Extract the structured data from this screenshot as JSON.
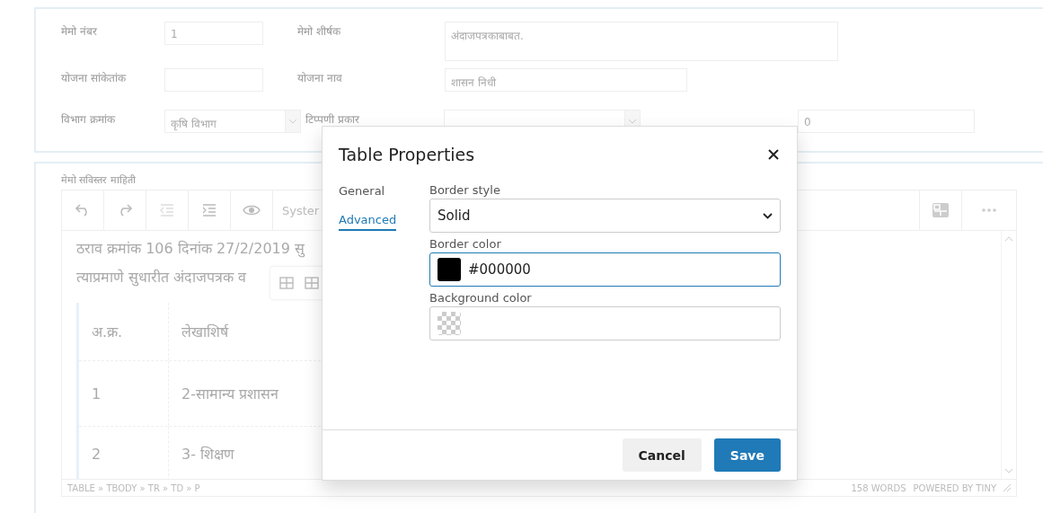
{
  "form": {
    "rows": [
      [
        {
          "label": "मेमो नंबर",
          "kind": "input",
          "value": "1"
        },
        {
          "label": "मेमो शीर्षक",
          "kind": "textarea",
          "value": "अंदाजपत्रकाबाबत."
        }
      ],
      [
        {
          "label": "योजना सांकेतांक",
          "kind": "input"
        },
        {
          "label": "योजना नाव",
          "kind": "input",
          "value": "शासन निधी"
        }
      ],
      [
        {
          "label": "विभाग क्रमांक",
          "kind": "select",
          "value": "कृषि विभाग"
        },
        {
          "label": "टिप्पणी प्रकार",
          "kind": "select"
        },
        {
          "kind": "input",
          "value": "0"
        }
      ]
    ]
  },
  "editor": {
    "label": "मेमो सविस्तर माहिती",
    "toolbar": [
      {
        "kind": "undo"
      },
      {
        "kind": "redo"
      },
      {
        "kind": "outdent",
        "disabled": true
      },
      {
        "kind": "indent",
        "disabled": false
      },
      {
        "kind": "preview"
      },
      {
        "kind": "font",
        "label": "Syster"
      }
    ],
    "toolbar_right": [
      {
        "kind": "layout"
      },
      {
        "kind": "more"
      }
    ],
    "paragraphs": [
      "ठराव क्रमांक 106 दिनांक 27/2/2019 सु",
      "त्याप्रमाणे सुधारीत अंदाजपत्रक व"
    ],
    "table_rows": [
      [
        "अ.क्र.",
        "लेखाशिर्ष"
      ],
      [
        "1",
        "2-सामान्य प्रशासन"
      ],
      [
        "2",
        "3- शिक्षण"
      ]
    ],
    "status_path": "TABLE » TBODY » TR » TD » P",
    "word_count": "158 WORDS",
    "branding": "POWERED BY TINY"
  },
  "dialog": {
    "title": "Table Properties",
    "tabs": [
      {
        "label": "General",
        "selected": false
      },
      {
        "label": "Advanced",
        "selected": true
      }
    ],
    "fields": [
      {
        "label": "Border style",
        "kind": "select",
        "value": "Solid"
      },
      {
        "label": "Border color",
        "kind": "color",
        "value": "#000000",
        "focused": true
      },
      {
        "label": "Background color",
        "kind": "color",
        "focused": false
      }
    ],
    "buttons": [
      {
        "label": "Cancel",
        "kind": "secondary"
      },
      {
        "label": "Save",
        "kind": "primary"
      }
    ]
  }
}
